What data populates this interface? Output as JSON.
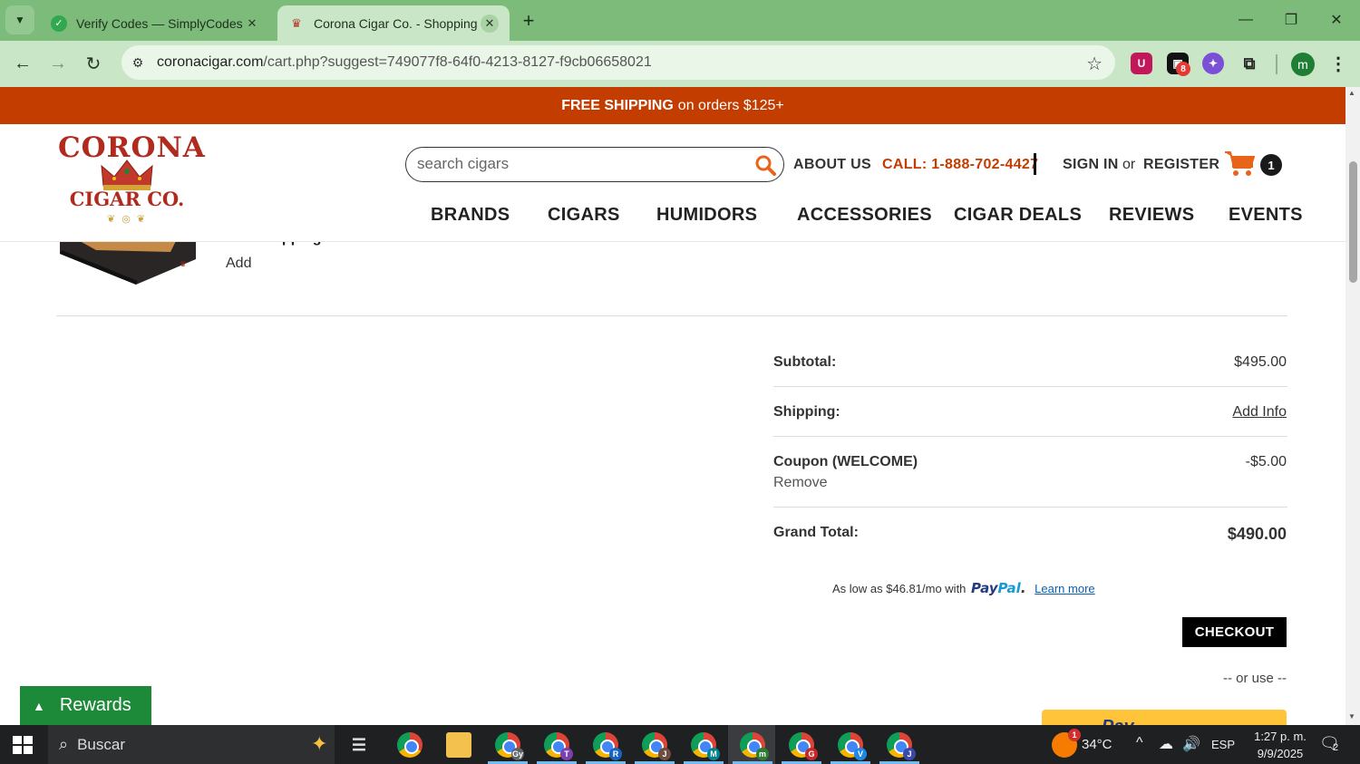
{
  "browser": {
    "tabs": [
      {
        "title": "Verify Codes — SimplyCodes",
        "active": false
      },
      {
        "title": "Corona Cigar Co. - Shopping C",
        "active": true
      }
    ],
    "new_tab_label": "+",
    "url_host": "coronacigar.com",
    "url_path": "/cart.php?suggest=749077f8-64f0-4213-8127-f9cb06658021",
    "extension_badge": "8",
    "profile_initial": "m"
  },
  "promo": {
    "bold": "FREE SHIPPING",
    "rest": "on orders $125+"
  },
  "header": {
    "logo": {
      "line1": "CORONA",
      "line2": "CIGAR CO."
    },
    "search_placeholder": "search cigars",
    "about": "ABOUT US",
    "call": "CALL: 1-888-702-4427",
    "sign_in": "SIGN IN",
    "or": "or",
    "register": "REGISTER",
    "cart_count": "1",
    "nav": [
      "BRANDS",
      "CIGARS",
      "HUMIDORS",
      "ACCESSORIES",
      "CIGAR DEALS",
      "REVIEWS",
      "EVENTS"
    ]
  },
  "cart_item": {
    "gift_wrapping_label": "Gift Wrapping:",
    "add_label": "Add"
  },
  "totals": {
    "subtotal_label": "Subtotal:",
    "subtotal_value": "$495.00",
    "shipping_label": "Shipping:",
    "shipping_value": "Add Info",
    "coupon_label": "Coupon (WELCOME)",
    "coupon_value": "-$5.00",
    "coupon_remove": "Remove",
    "grand_label": "Grand Total:",
    "grand_value": "$490.00"
  },
  "paypal": {
    "as_low": "As low as $46.81/mo with",
    "logo_pay": "Pay",
    "logo_pal": "Pal",
    "learn_more": "Learn more"
  },
  "checkout_label": "CHECKOUT",
  "or_use": "-- or use --",
  "rewards_label": "Rewards",
  "taskbar": {
    "search_text": "Buscar",
    "weather": "34°C",
    "weather_badge": "1",
    "language": "ESP",
    "time": "1:27 p. m.",
    "date": "9/9/2025",
    "notifications": "2",
    "app_letters": [
      "Gy",
      "T",
      "R",
      "J",
      "M",
      "m",
      "G",
      "V",
      "J"
    ]
  }
}
